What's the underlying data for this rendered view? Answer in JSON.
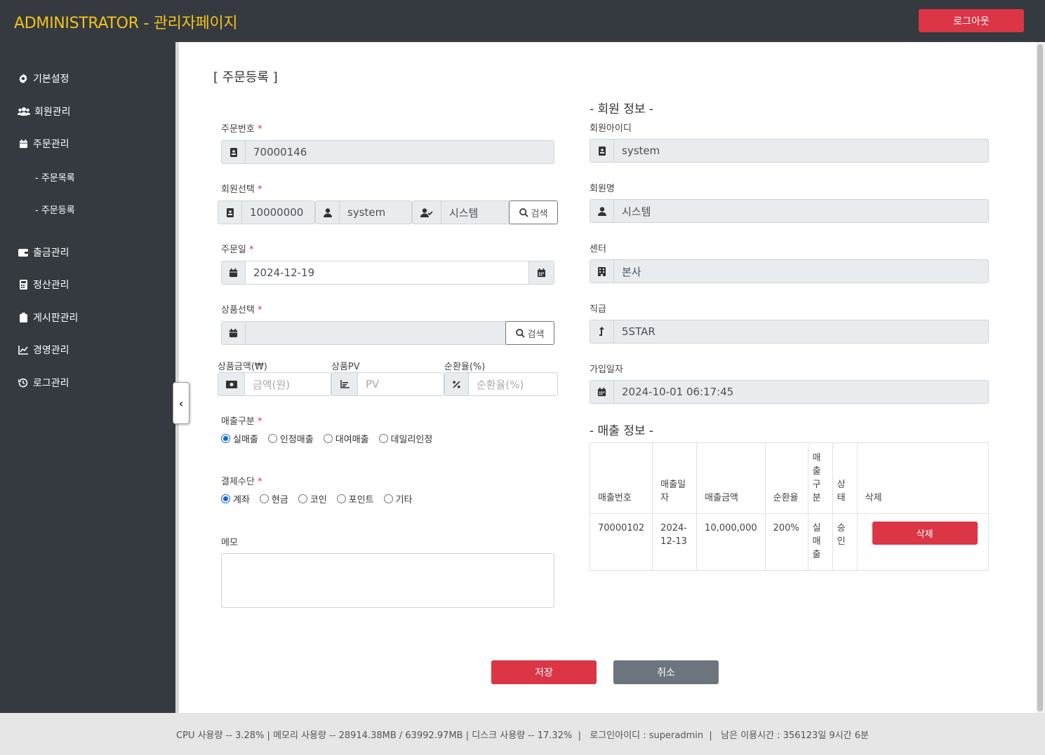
{
  "header": {
    "title": "ADMINISTRATOR - 관리자페이지",
    "logout_label": "로그아웃"
  },
  "sidebar": {
    "items": [
      {
        "label": "기본설정",
        "icon": "gear-icon"
      },
      {
        "label": "회원관리",
        "icon": "users-icon"
      },
      {
        "label": "주문관리",
        "icon": "calendar-icon"
      },
      {
        "label": "출금관리",
        "icon": "wallet-icon"
      },
      {
        "label": "정산관리",
        "icon": "calculator-icon"
      },
      {
        "label": "게시판관리",
        "icon": "clipboard-icon"
      },
      {
        "label": "경영관리",
        "icon": "line-chart-icon"
      },
      {
        "label": "로그관리",
        "icon": "history-icon"
      }
    ],
    "subitems": [
      {
        "label": "- 주문목록"
      },
      {
        "label": "- 주문등록"
      }
    ],
    "collapse_icon": "‹"
  },
  "page": {
    "title": "[ 주문등록 ]"
  },
  "form": {
    "order_no": {
      "label": "주문번호",
      "value": "70000146"
    },
    "member_select": {
      "label": "회원선택",
      "id": "10000000",
      "username": "system",
      "name": "시스템",
      "search_label": "검색"
    },
    "order_date": {
      "label": "주문일",
      "value": "2024-12-19"
    },
    "product_select": {
      "label": "상품선택",
      "value": "",
      "search_label": "검색"
    },
    "product_amount": {
      "label": "상품금액(₩)",
      "placeholder": "금액(원)"
    },
    "product_pv": {
      "label": "상품PV",
      "placeholder": "PV"
    },
    "return_rate": {
      "label": "순환율(%)",
      "placeholder": "순환율(%)"
    },
    "sales_type": {
      "label": "매출구분",
      "options": [
        "실매출",
        "인정매출",
        "대여매출",
        "데일리인정"
      ],
      "selected": "실매출"
    },
    "payment": {
      "label": "결제수단",
      "options": [
        "계좌",
        "현금",
        "코인",
        "포인트",
        "기타"
      ],
      "selected": "계좌"
    },
    "memo": {
      "label": "메모",
      "value": ""
    },
    "required_mark": "*"
  },
  "member_info": {
    "title": "- 회원 정보 -",
    "id": {
      "label": "회원아이디",
      "value": "system"
    },
    "name": {
      "label": "회원명",
      "value": "시스템"
    },
    "center": {
      "label": "센터",
      "value": "본사"
    },
    "rank": {
      "label": "직급",
      "value": "5STAR"
    },
    "join_date": {
      "label": "가입일자",
      "value": "2024-10-01 06:17:45"
    }
  },
  "sales_info": {
    "title": "- 매출 정보 -",
    "headers": [
      "매출번호",
      "매출일자",
      "매출금액",
      "순환율",
      "매출구분",
      "상태",
      "삭제"
    ],
    "rows": [
      {
        "no": "70000102",
        "date": "2024-12-13",
        "amount": "10,000,000",
        "rate": "200%",
        "type": "실매출",
        "status": "승인",
        "delete_label": "삭제"
      }
    ]
  },
  "actions": {
    "save_label": "저장",
    "cancel_label": "취소"
  },
  "footer": {
    "text": "CPU 사용량 -- 3.28% | 메모리 사용량 -- 28914.38MB / 63992.97MB | 디스크 사용량 -- 17.32%  |   로그인아이디 : superadmin  |   남은 이용시간 : 356123일 9시간 6분"
  },
  "colors": {
    "topbar": "#343a40",
    "brand": "#f4c21b",
    "danger": "#dc3545",
    "secondary": "#6c757d"
  }
}
